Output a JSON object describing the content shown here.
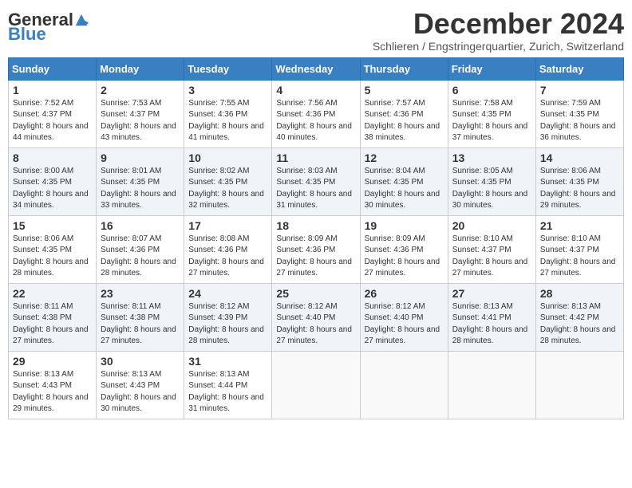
{
  "logo": {
    "general": "General",
    "blue": "Blue"
  },
  "title": "December 2024",
  "subtitle": "Schlieren / Engstringerquartier, Zurich, Switzerland",
  "weekdays": [
    "Sunday",
    "Monday",
    "Tuesday",
    "Wednesday",
    "Thursday",
    "Friday",
    "Saturday"
  ],
  "weeks": [
    [
      {
        "day": "1",
        "sunrise": "7:52 AM",
        "sunset": "4:37 PM",
        "daylight": "8 hours and 44 minutes."
      },
      {
        "day": "2",
        "sunrise": "7:53 AM",
        "sunset": "4:37 PM",
        "daylight": "8 hours and 43 minutes."
      },
      {
        "day": "3",
        "sunrise": "7:55 AM",
        "sunset": "4:36 PM",
        "daylight": "8 hours and 41 minutes."
      },
      {
        "day": "4",
        "sunrise": "7:56 AM",
        "sunset": "4:36 PM",
        "daylight": "8 hours and 40 minutes."
      },
      {
        "day": "5",
        "sunrise": "7:57 AM",
        "sunset": "4:36 PM",
        "daylight": "8 hours and 38 minutes."
      },
      {
        "day": "6",
        "sunrise": "7:58 AM",
        "sunset": "4:35 PM",
        "daylight": "8 hours and 37 minutes."
      },
      {
        "day": "7",
        "sunrise": "7:59 AM",
        "sunset": "4:35 PM",
        "daylight": "8 hours and 36 minutes."
      }
    ],
    [
      {
        "day": "8",
        "sunrise": "8:00 AM",
        "sunset": "4:35 PM",
        "daylight": "8 hours and 34 minutes."
      },
      {
        "day": "9",
        "sunrise": "8:01 AM",
        "sunset": "4:35 PM",
        "daylight": "8 hours and 33 minutes."
      },
      {
        "day": "10",
        "sunrise": "8:02 AM",
        "sunset": "4:35 PM",
        "daylight": "8 hours and 32 minutes."
      },
      {
        "day": "11",
        "sunrise": "8:03 AM",
        "sunset": "4:35 PM",
        "daylight": "8 hours and 31 minutes."
      },
      {
        "day": "12",
        "sunrise": "8:04 AM",
        "sunset": "4:35 PM",
        "daylight": "8 hours and 30 minutes."
      },
      {
        "day": "13",
        "sunrise": "8:05 AM",
        "sunset": "4:35 PM",
        "daylight": "8 hours and 30 minutes."
      },
      {
        "day": "14",
        "sunrise": "8:06 AM",
        "sunset": "4:35 PM",
        "daylight": "8 hours and 29 minutes."
      }
    ],
    [
      {
        "day": "15",
        "sunrise": "8:06 AM",
        "sunset": "4:35 PM",
        "daylight": "8 hours and 28 minutes."
      },
      {
        "day": "16",
        "sunrise": "8:07 AM",
        "sunset": "4:36 PM",
        "daylight": "8 hours and 28 minutes."
      },
      {
        "day": "17",
        "sunrise": "8:08 AM",
        "sunset": "4:36 PM",
        "daylight": "8 hours and 27 minutes."
      },
      {
        "day": "18",
        "sunrise": "8:09 AM",
        "sunset": "4:36 PM",
        "daylight": "8 hours and 27 minutes."
      },
      {
        "day": "19",
        "sunrise": "8:09 AM",
        "sunset": "4:36 PM",
        "daylight": "8 hours and 27 minutes."
      },
      {
        "day": "20",
        "sunrise": "8:10 AM",
        "sunset": "4:37 PM",
        "daylight": "8 hours and 27 minutes."
      },
      {
        "day": "21",
        "sunrise": "8:10 AM",
        "sunset": "4:37 PM",
        "daylight": "8 hours and 27 minutes."
      }
    ],
    [
      {
        "day": "22",
        "sunrise": "8:11 AM",
        "sunset": "4:38 PM",
        "daylight": "8 hours and 27 minutes."
      },
      {
        "day": "23",
        "sunrise": "8:11 AM",
        "sunset": "4:38 PM",
        "daylight": "8 hours and 27 minutes."
      },
      {
        "day": "24",
        "sunrise": "8:12 AM",
        "sunset": "4:39 PM",
        "daylight": "8 hours and 28 minutes."
      },
      {
        "day": "25",
        "sunrise": "8:12 AM",
        "sunset": "4:40 PM",
        "daylight": "8 hours and 27 minutes."
      },
      {
        "day": "26",
        "sunrise": "8:12 AM",
        "sunset": "4:40 PM",
        "daylight": "8 hours and 27 minutes."
      },
      {
        "day": "27",
        "sunrise": "8:13 AM",
        "sunset": "4:41 PM",
        "daylight": "8 hours and 28 minutes."
      },
      {
        "day": "28",
        "sunrise": "8:13 AM",
        "sunset": "4:42 PM",
        "daylight": "8 hours and 28 minutes."
      }
    ],
    [
      {
        "day": "29",
        "sunrise": "8:13 AM",
        "sunset": "4:43 PM",
        "daylight": "8 hours and 29 minutes."
      },
      {
        "day": "30",
        "sunrise": "8:13 AM",
        "sunset": "4:43 PM",
        "daylight": "8 hours and 30 minutes."
      },
      {
        "day": "31",
        "sunrise": "8:13 AM",
        "sunset": "4:44 PM",
        "daylight": "8 hours and 31 minutes."
      },
      null,
      null,
      null,
      null
    ]
  ],
  "labels": {
    "sunrise": "Sunrise:",
    "sunset": "Sunset:",
    "daylight": "Daylight:"
  }
}
